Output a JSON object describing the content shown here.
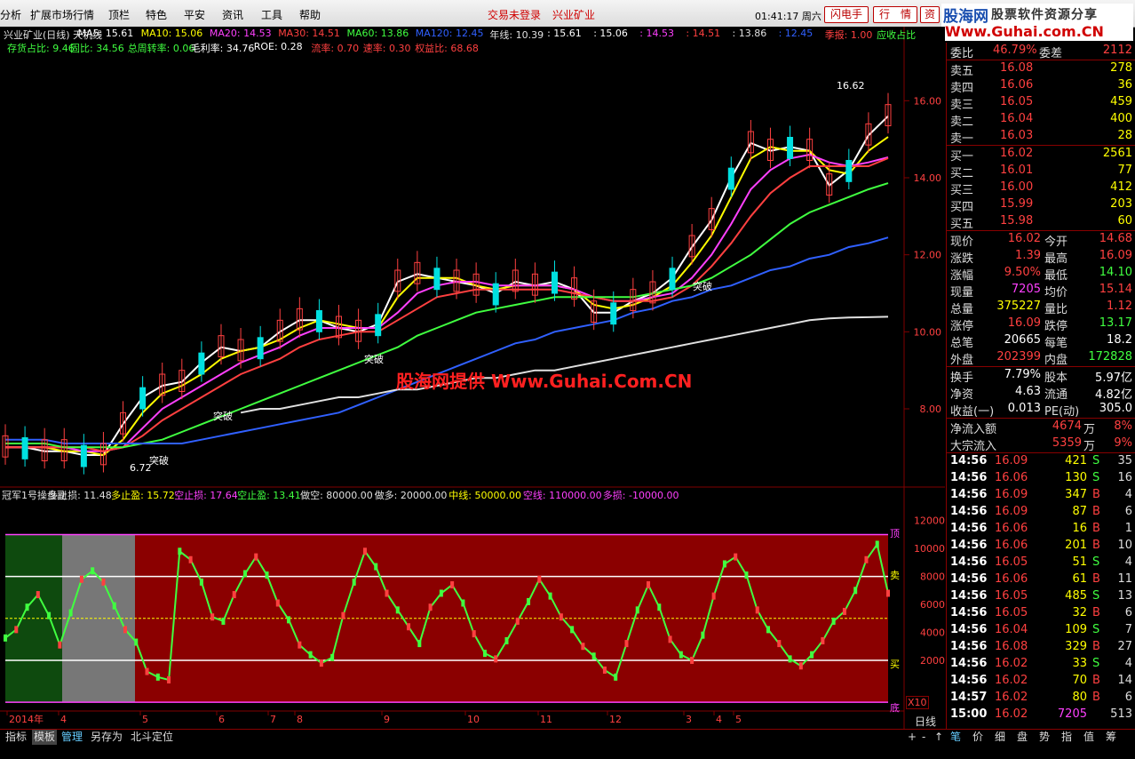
{
  "menu": {
    "items": [
      "分析",
      "扩展市场行情",
      "顶栏",
      "特色",
      "平安",
      "资讯",
      "工具",
      "帮助"
    ],
    "login_status": "交易未登录",
    "stock_name": "兴业矿业",
    "time": "01:41:17 周六",
    "btn_flash": "闪电手",
    "btn_quote": "行　情",
    "btn_info": "资"
  },
  "logo": {
    "cn": "股海网",
    "slogan": "股票软件资源分享",
    "url": "Www.Guhai.com.CN"
  },
  "watermark": "股海网提供 Www.Guhai.Com.CN",
  "info_line1": [
    {
      "t": "兴业矿业(日线) 天机线",
      "c": "#e0e0e0"
    },
    {
      "t": "MA5: 15.61",
      "c": "#ffffff"
    },
    {
      "t": "MA10: 15.06",
      "c": "#ffff00"
    },
    {
      "t": "MA20: 14.53",
      "c": "#ff40ff"
    },
    {
      "t": "MA30: 14.51",
      "c": "#ff4040"
    },
    {
      "t": "MA60: 13.86",
      "c": "#40ff40"
    },
    {
      "t": "MA120: 12.45",
      "c": "#3060ff"
    },
    {
      "t": "年线: 10.39",
      "c": "#e0e0e0"
    },
    {
      "t": ": 15.61",
      "c": "#ffffff"
    },
    {
      "t": ": 15.06",
      "c": "#ffffff"
    },
    {
      "t": ": 14.53",
      "c": "#ff40ff"
    },
    {
      "t": ": 14.51",
      "c": "#ff4040"
    },
    {
      "t": ": 13.86",
      "c": "#e0e0e0"
    },
    {
      "t": ": 12.45",
      "c": "#3060ff"
    },
    {
      "t": "季报: 1.00",
      "c": "#ff4040"
    },
    {
      "t": "应收占比",
      "c": "#40ff40"
    }
  ],
  "info_line2": [
    {
      "t": "存货占比: 9.46",
      "c": "#40ff40"
    },
    {
      "t": "固比: 34.56",
      "c": "#40ff40"
    },
    {
      "t": "总周转率: 0.06",
      "c": "#40ff40"
    },
    {
      "t": "毛利率: 34.76",
      "c": "#ffffff"
    },
    {
      "t": "ROE: 0.28",
      "c": "#ffffff"
    },
    {
      "t": "流率: 0.70",
      "c": "#ff4040"
    },
    {
      "t": "速率: 0.30",
      "c": "#ff4040"
    },
    {
      "t": "权益比: 68.68",
      "c": "#ff4040"
    }
  ],
  "ind_line": [
    {
      "t": "冠军1号操盘副",
      "c": "#e0e0e0"
    },
    {
      "t": "多止损: 11.48",
      "c": "#e0e0e0"
    },
    {
      "t": "多止盈: 15.72",
      "c": "#ffff00"
    },
    {
      "t": "空止损: 17.64",
      "c": "#ff40ff"
    },
    {
      "t": "空止盈: 13.41",
      "c": "#40ff40"
    },
    {
      "t": "做空: 80000.00",
      "c": "#e0e0e0"
    },
    {
      "t": "做多: 20000.00",
      "c": "#e0e0e0"
    },
    {
      "t": "中线: 50000.00",
      "c": "#ffff00"
    },
    {
      "t": "空线: 110000.00",
      "c": "#ff40ff"
    },
    {
      "t": "多损: -10000.00",
      "c": "#ff40ff"
    }
  ],
  "chart_data": [
    {
      "type": "line",
      "title": "兴业矿业(日线) 天机线",
      "y_ticks": [
        "16.00",
        "14.00",
        "12.00",
        "10.00",
        "8.00"
      ],
      "ylim": [
        6.2,
        17.0
      ],
      "x_months": [
        "2014年",
        "4",
        "5",
        "6",
        "7",
        "8",
        "9",
        "10",
        "11",
        "12",
        "3",
        "4",
        "5"
      ],
      "annotations": {
        "high_label": "16.62",
        "low_label": "6.72",
        "breakouts": [
          "突破",
          "突破",
          "突破",
          "突破",
          "突破"
        ]
      },
      "series": [
        {
          "name": "MA5",
          "color": "#ffffff",
          "values": [
            7.0,
            7.0,
            6.9,
            6.9,
            6.8,
            6.8,
            7.6,
            8.3,
            8.6,
            8.7,
            9.2,
            9.6,
            9.5,
            9.6,
            10.0,
            10.3,
            10.3,
            10.1,
            10.0,
            10.2,
            11.3,
            11.5,
            11.4,
            11.3,
            11.2,
            11.0,
            11.3,
            11.2,
            11.3,
            11.1,
            10.5,
            10.5,
            10.8,
            11.0,
            11.4,
            12.2,
            12.9,
            14.0,
            14.9,
            14.7,
            14.8,
            14.7,
            13.8,
            14.2,
            15.1,
            15.6
          ]
        },
        {
          "name": "MA10",
          "color": "#ffff00",
          "values": [
            7.0,
            7.0,
            7.0,
            6.9,
            6.9,
            6.8,
            7.2,
            7.9,
            8.4,
            8.6,
            8.9,
            9.3,
            9.5,
            9.6,
            9.8,
            10.1,
            10.3,
            10.2,
            10.1,
            10.1,
            10.9,
            11.4,
            11.4,
            11.4,
            11.2,
            11.1,
            11.2,
            11.2,
            11.2,
            11.1,
            10.7,
            10.6,
            10.7,
            10.9,
            11.2,
            11.8,
            12.5,
            13.5,
            14.5,
            14.8,
            14.7,
            14.7,
            14.2,
            14.1,
            14.7,
            15.06
          ]
        },
        {
          "name": "MA20",
          "color": "#ff40ff",
          "values": [
            7.0,
            7.0,
            7.0,
            7.0,
            6.9,
            6.9,
            7.0,
            7.5,
            8.0,
            8.3,
            8.6,
            8.9,
            9.2,
            9.4,
            9.6,
            9.9,
            10.1,
            10.1,
            10.1,
            10.1,
            10.5,
            11.0,
            11.2,
            11.3,
            11.3,
            11.2,
            11.2,
            11.2,
            11.2,
            11.1,
            10.9,
            10.8,
            10.8,
            10.9,
            11.0,
            11.4,
            12.0,
            12.8,
            13.7,
            14.2,
            14.5,
            14.6,
            14.4,
            14.3,
            14.4,
            14.53
          ]
        },
        {
          "name": "MA30",
          "color": "#ff4040",
          "values": [
            7.0,
            7.0,
            7.0,
            7.0,
            7.0,
            6.9,
            7.0,
            7.3,
            7.7,
            8.0,
            8.3,
            8.6,
            8.9,
            9.1,
            9.3,
            9.6,
            9.8,
            9.9,
            10.0,
            10.0,
            10.3,
            10.6,
            10.9,
            11.0,
            11.1,
            11.1,
            11.1,
            11.1,
            11.1,
            11.0,
            10.9,
            10.8,
            10.8,
            10.8,
            10.9,
            11.2,
            11.7,
            12.3,
            13.0,
            13.6,
            14.0,
            14.3,
            14.3,
            14.3,
            14.3,
            14.51
          ]
        },
        {
          "name": "MA60",
          "color": "#40ff40",
          "values": [
            7.1,
            7.1,
            7.1,
            7.0,
            7.0,
            7.0,
            7.0,
            7.1,
            7.2,
            7.4,
            7.6,
            7.8,
            8.0,
            8.2,
            8.4,
            8.6,
            8.8,
            9.0,
            9.2,
            9.4,
            9.6,
            9.9,
            10.1,
            10.3,
            10.5,
            10.6,
            10.7,
            10.8,
            10.9,
            10.9,
            10.9,
            10.9,
            10.9,
            11.0,
            11.1,
            11.2,
            11.4,
            11.7,
            12.0,
            12.4,
            12.8,
            13.1,
            13.3,
            13.5,
            13.7,
            13.86
          ]
        },
        {
          "name": "MA120",
          "color": "#3060ff",
          "values": [
            7.2,
            7.2,
            7.2,
            7.1,
            7.1,
            7.1,
            7.1,
            7.1,
            7.1,
            7.1,
            7.2,
            7.3,
            7.4,
            7.5,
            7.6,
            7.7,
            7.8,
            7.9,
            8.1,
            8.3,
            8.5,
            8.7,
            8.9,
            9.1,
            9.3,
            9.5,
            9.7,
            9.8,
            10.0,
            10.1,
            10.2,
            10.3,
            10.5,
            10.6,
            10.8,
            10.9,
            11.1,
            11.2,
            11.4,
            11.6,
            11.7,
            11.9,
            12.0,
            12.2,
            12.3,
            12.45
          ]
        },
        {
          "name": "年线",
          "color": "#e0e0e0",
          "values": [
            null,
            null,
            null,
            null,
            null,
            null,
            null,
            null,
            null,
            null,
            null,
            null,
            7.9,
            8.0,
            8.0,
            8.1,
            8.2,
            8.3,
            8.3,
            8.4,
            8.5,
            8.5,
            8.6,
            8.7,
            8.8,
            8.8,
            8.9,
            9.0,
            9.0,
            9.1,
            9.2,
            9.3,
            9.4,
            9.5,
            9.6,
            9.7,
            9.8,
            9.9,
            10.0,
            10.1,
            10.2,
            10.3,
            10.35,
            10.37,
            10.38,
            10.39
          ]
        }
      ]
    },
    {
      "type": "line",
      "title": "冠军1号操盘副",
      "y_ticks": [
        "12000",
        "10000",
        "8000",
        "6000",
        "4000",
        "2000"
      ],
      "ylim": [
        -1500,
        13000
      ],
      "levels": {
        "做空": 8000,
        "做多": 2000,
        "中线": 5000,
        "空线": 11000,
        "多损": -1000
      },
      "side_labels": [
        "顶",
        "卖",
        "买",
        "底"
      ],
      "zoom_label": "X10",
      "series": [
        {
          "name": "操盘线",
          "color": "#40ff40",
          "values": [
            3600,
            4200,
            5800,
            6700,
            5200,
            3100,
            5400,
            7800,
            8400,
            7600,
            5900,
            4200,
            3300,
            1200,
            800,
            600,
            9800,
            9200,
            7600,
            5100,
            4800,
            6700,
            8200,
            9400,
            8100,
            6100,
            4900,
            3100,
            2400,
            1800,
            2200,
            5200,
            7600,
            9800,
            8700,
            6800,
            5600,
            4400,
            3200,
            5800,
            6800,
            7400,
            6100,
            3900,
            2500,
            2100,
            3400,
            4800,
            6200,
            7800,
            6600,
            5100,
            4200,
            3000,
            2300,
            1300,
            800,
            3200,
            5600,
            7400,
            5800,
            3500,
            2400,
            2000,
            3800,
            6600,
            8900,
            9400,
            8100,
            5600,
            4200,
            3200,
            2100,
            1600,
            2400,
            3400,
            4800,
            5500,
            7000,
            9200,
            10300,
            6800
          ]
        }
      ]
    }
  ],
  "quotes": {
    "weibi": {
      "l1": "委比",
      "v1": "46.79%",
      "l2": "委差",
      "v2": "2112"
    },
    "sell": [
      {
        "l": "卖五",
        "p": "16.08",
        "q": "278"
      },
      {
        "l": "卖四",
        "p": "16.06",
        "q": "36"
      },
      {
        "l": "卖三",
        "p": "16.05",
        "q": "459"
      },
      {
        "l": "卖二",
        "p": "16.04",
        "q": "400"
      },
      {
        "l": "卖一",
        "p": "16.03",
        "q": "28"
      }
    ],
    "buy": [
      {
        "l": "买一",
        "p": "16.02",
        "q": "2561"
      },
      {
        "l": "买二",
        "p": "16.01",
        "q": "77"
      },
      {
        "l": "买三",
        "p": "16.00",
        "q": "412"
      },
      {
        "l": "买四",
        "p": "15.99",
        "q": "203"
      },
      {
        "l": "买五",
        "p": "15.98",
        "q": "60"
      }
    ],
    "stats": [
      {
        "l1": "现价",
        "v1": "16.02",
        "c1": "#ff4040",
        "l2": "今开",
        "v2": "14.68",
        "c2": "#ff4040"
      },
      {
        "l1": "涨跌",
        "v1": "1.39",
        "c1": "#ff4040",
        "l2": "最高",
        "v2": "16.09",
        "c2": "#ff4040"
      },
      {
        "l1": "涨幅",
        "v1": "9.50%",
        "c1": "#ff4040",
        "l2": "最低",
        "v2": "14.10",
        "c2": "#40ff40"
      },
      {
        "l1": "现量",
        "v1": "7205",
        "c1": "#ff40ff",
        "l2": "均价",
        "v2": "15.14",
        "c2": "#ff4040"
      },
      {
        "l1": "总量",
        "v1": "375227",
        "c1": "#ffff00",
        "l2": "量比",
        "v2": "1.12",
        "c2": "#ff4040"
      },
      {
        "l1": "涨停",
        "v1": "16.09",
        "c1": "#ff4040",
        "l2": "跌停",
        "v2": "13.17",
        "c2": "#40ff40"
      },
      {
        "l1": "总笔",
        "v1": "20665",
        "c1": "#ffffff",
        "l2": "每笔",
        "v2": "18.2",
        "c2": "#ffffff"
      },
      {
        "l1": "外盘",
        "v1": "202399",
        "c1": "#ff4040",
        "l2": "内盘",
        "v2": "172828",
        "c2": "#40ff40"
      }
    ],
    "finance": [
      {
        "l1": "换手",
        "v1": "7.79%",
        "l2": "股本",
        "v2": "5.97亿"
      },
      {
        "l1": "净资",
        "v1": "4.63",
        "l2": "流通",
        "v2": "4.82亿"
      },
      {
        "l1": "收益(一)",
        "v1": "0.013",
        "l2": "PE(动)",
        "v2": "305.0"
      }
    ],
    "flows": [
      {
        "l": "净流入额",
        "v": "4674",
        "u": "万",
        "p": "8%"
      },
      {
        "l": "大宗流入",
        "v": "5359",
        "u": "万",
        "p": "9%"
      }
    ],
    "ticks": [
      {
        "t": "14:56",
        "p": "16.09",
        "v": "421",
        "d": "S",
        "n": "35"
      },
      {
        "t": "14:56",
        "p": "16.06",
        "v": "130",
        "d": "S",
        "n": "16"
      },
      {
        "t": "14:56",
        "p": "16.09",
        "v": "347",
        "d": "B",
        "n": "4"
      },
      {
        "t": "14:56",
        "p": "16.09",
        "v": "87",
        "d": "B",
        "n": "6"
      },
      {
        "t": "14:56",
        "p": "16.06",
        "v": "16",
        "d": "B",
        "n": "1"
      },
      {
        "t": "14:56",
        "p": "16.06",
        "v": "201",
        "d": "B",
        "n": "10"
      },
      {
        "t": "14:56",
        "p": "16.05",
        "v": "51",
        "d": "S",
        "n": "4"
      },
      {
        "t": "14:56",
        "p": "16.06",
        "v": "61",
        "d": "B",
        "n": "11"
      },
      {
        "t": "14:56",
        "p": "16.05",
        "v": "485",
        "d": "S",
        "n": "13"
      },
      {
        "t": "14:56",
        "p": "16.05",
        "v": "32",
        "d": "B",
        "n": "6"
      },
      {
        "t": "14:56",
        "p": "16.04",
        "v": "109",
        "d": "S",
        "n": "7"
      },
      {
        "t": "14:56",
        "p": "16.08",
        "v": "329",
        "d": "B",
        "n": "27"
      },
      {
        "t": "14:56",
        "p": "16.02",
        "v": "33",
        "d": "S",
        "n": "4"
      },
      {
        "t": "14:56",
        "p": "16.02",
        "v": "70",
        "d": "B",
        "n": "14"
      },
      {
        "t": "14:57",
        "p": "16.02",
        "v": "80",
        "d": "B",
        "n": "6"
      },
      {
        "t": "15:00",
        "p": "16.02",
        "v": "7205",
        "d": "",
        "n": "513"
      }
    ]
  },
  "period_label": "日线",
  "bottom_tabs": [
    "指标",
    "模板",
    "管理",
    "另存为",
    "北斗定位"
  ],
  "right_tabs": [
    "笔",
    "价",
    "细",
    "盘",
    "势",
    "指",
    "值",
    "筹"
  ],
  "nav_arrows": [
    "+",
    "-",
    "↑",
    "≡"
  ],
  "colors": {
    "up": "#ff4040",
    "down": "#40ff40",
    "panel_red": "#8b0000",
    "panel_green": "#0e4a0e",
    "panel_gray": "#777777"
  }
}
